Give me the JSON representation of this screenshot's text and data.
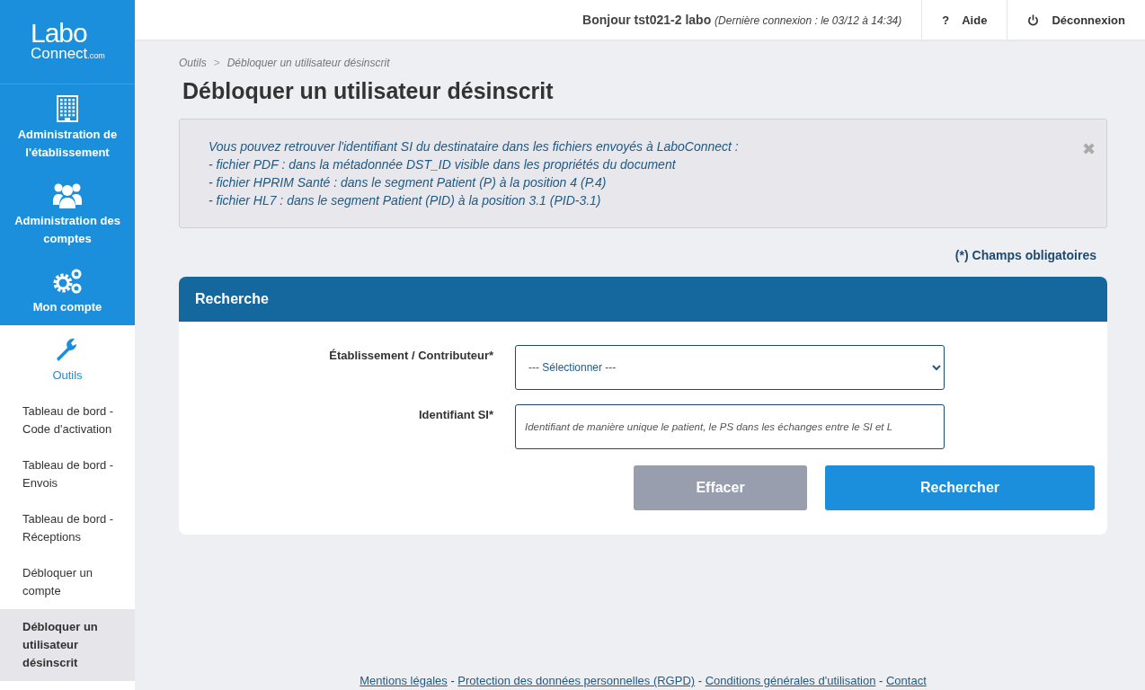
{
  "logo": {
    "line_1": "Labo",
    "line_2": "Connect",
    "suffix": ".com"
  },
  "sidebar": {
    "items": [
      {
        "kind": "building",
        "label": "Administration de l'établissement",
        "selected": false
      },
      {
        "kind": "users",
        "label": "Administration des comptes",
        "selected": false
      },
      {
        "kind": "gears",
        "label": "Mon compte",
        "selected": false
      },
      {
        "kind": "wrench",
        "label": "Outils",
        "selected": true
      }
    ],
    "subitems": [
      {
        "label": "Tableau de bord - Code d'activation",
        "selected": false
      },
      {
        "label": "Tableau de bord - Envois",
        "selected": false
      },
      {
        "label": "Tableau de bord - Réceptions",
        "selected": false
      },
      {
        "label": "Débloquer un compte",
        "selected": false
      },
      {
        "label": "Débloquer un utilisateur désinscrit",
        "selected": true
      }
    ]
  },
  "header": {
    "greeting": "Bonjour tst021-2 labo",
    "last_login": "(Dernière connexion : le 03/12 à 14:34)",
    "help_icon": "?",
    "help": "Aide",
    "logout": "Déconnexion"
  },
  "breadcrumb": [
    "Outils",
    "Débloquer un utilisateur désinscrit"
  ],
  "breadcrumb_separator": ">",
  "title": "Débloquer un utilisateur désinscrit",
  "info": {
    "lines": [
      "Vous pouvez retrouver l'identifiant SI du destinataire dans les fichiers envoyés à LaboConnect :",
      "- fichier PDF : dans la métadonnée DST_ID visible dans les propriétés du document",
      "- fichier HPRIM Santé : dans le segment Patient (P) à la position 4 (P.4)",
      "- fichier HL7 : dans le segment Patient (PID) à la position 3.1 (PID-3.1)"
    ],
    "close": "✖"
  },
  "required_note": "(*) Champs obligatoires",
  "panel": {
    "title": "Recherche",
    "fields": [
      {
        "kind": "select",
        "label": "Établissement / Contributeur*",
        "value": "--- Sélectionner ---"
      },
      {
        "kind": "text",
        "label": "Identifiant SI*",
        "placeholder": "Identifiant de manière unique le patient, le PS dans les échanges entre le SI et L"
      }
    ],
    "buttons": [
      {
        "kind": "secondary",
        "label": "Effacer"
      },
      {
        "kind": "primary",
        "label": "Rechercher"
      }
    ]
  },
  "footer": {
    "links": [
      "Mentions légales",
      "Protection des données personnelles (RGPD)",
      "Conditions générales d'utilisation",
      "Contact"
    ],
    "separator": "-"
  }
}
